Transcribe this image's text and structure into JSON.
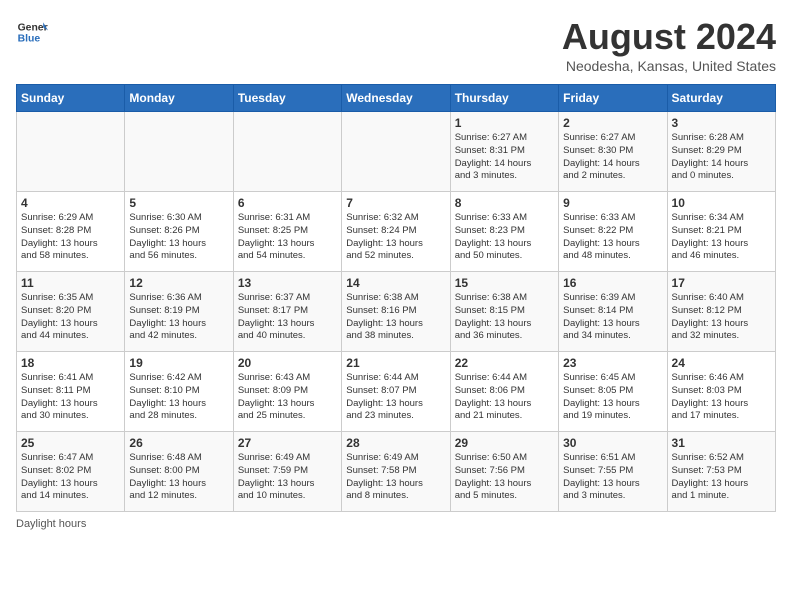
{
  "logo": {
    "line1": "General",
    "line2": "Blue"
  },
  "title": "August 2024",
  "subtitle": "Neodesha, Kansas, United States",
  "days_of_week": [
    "Sunday",
    "Monday",
    "Tuesday",
    "Wednesday",
    "Thursday",
    "Friday",
    "Saturday"
  ],
  "footer_text": "Daylight hours",
  "weeks": [
    [
      {
        "day": "",
        "info": ""
      },
      {
        "day": "",
        "info": ""
      },
      {
        "day": "",
        "info": ""
      },
      {
        "day": "",
        "info": ""
      },
      {
        "day": "1",
        "info": "Sunrise: 6:27 AM\nSunset: 8:31 PM\nDaylight: 14 hours\nand 3 minutes."
      },
      {
        "day": "2",
        "info": "Sunrise: 6:27 AM\nSunset: 8:30 PM\nDaylight: 14 hours\nand 2 minutes."
      },
      {
        "day": "3",
        "info": "Sunrise: 6:28 AM\nSunset: 8:29 PM\nDaylight: 14 hours\nand 0 minutes."
      }
    ],
    [
      {
        "day": "4",
        "info": "Sunrise: 6:29 AM\nSunset: 8:28 PM\nDaylight: 13 hours\nand 58 minutes."
      },
      {
        "day": "5",
        "info": "Sunrise: 6:30 AM\nSunset: 8:26 PM\nDaylight: 13 hours\nand 56 minutes."
      },
      {
        "day": "6",
        "info": "Sunrise: 6:31 AM\nSunset: 8:25 PM\nDaylight: 13 hours\nand 54 minutes."
      },
      {
        "day": "7",
        "info": "Sunrise: 6:32 AM\nSunset: 8:24 PM\nDaylight: 13 hours\nand 52 minutes."
      },
      {
        "day": "8",
        "info": "Sunrise: 6:33 AM\nSunset: 8:23 PM\nDaylight: 13 hours\nand 50 minutes."
      },
      {
        "day": "9",
        "info": "Sunrise: 6:33 AM\nSunset: 8:22 PM\nDaylight: 13 hours\nand 48 minutes."
      },
      {
        "day": "10",
        "info": "Sunrise: 6:34 AM\nSunset: 8:21 PM\nDaylight: 13 hours\nand 46 minutes."
      }
    ],
    [
      {
        "day": "11",
        "info": "Sunrise: 6:35 AM\nSunset: 8:20 PM\nDaylight: 13 hours\nand 44 minutes."
      },
      {
        "day": "12",
        "info": "Sunrise: 6:36 AM\nSunset: 8:19 PM\nDaylight: 13 hours\nand 42 minutes."
      },
      {
        "day": "13",
        "info": "Sunrise: 6:37 AM\nSunset: 8:17 PM\nDaylight: 13 hours\nand 40 minutes."
      },
      {
        "day": "14",
        "info": "Sunrise: 6:38 AM\nSunset: 8:16 PM\nDaylight: 13 hours\nand 38 minutes."
      },
      {
        "day": "15",
        "info": "Sunrise: 6:38 AM\nSunset: 8:15 PM\nDaylight: 13 hours\nand 36 minutes."
      },
      {
        "day": "16",
        "info": "Sunrise: 6:39 AM\nSunset: 8:14 PM\nDaylight: 13 hours\nand 34 minutes."
      },
      {
        "day": "17",
        "info": "Sunrise: 6:40 AM\nSunset: 8:12 PM\nDaylight: 13 hours\nand 32 minutes."
      }
    ],
    [
      {
        "day": "18",
        "info": "Sunrise: 6:41 AM\nSunset: 8:11 PM\nDaylight: 13 hours\nand 30 minutes."
      },
      {
        "day": "19",
        "info": "Sunrise: 6:42 AM\nSunset: 8:10 PM\nDaylight: 13 hours\nand 28 minutes."
      },
      {
        "day": "20",
        "info": "Sunrise: 6:43 AM\nSunset: 8:09 PM\nDaylight: 13 hours\nand 25 minutes."
      },
      {
        "day": "21",
        "info": "Sunrise: 6:44 AM\nSunset: 8:07 PM\nDaylight: 13 hours\nand 23 minutes."
      },
      {
        "day": "22",
        "info": "Sunrise: 6:44 AM\nSunset: 8:06 PM\nDaylight: 13 hours\nand 21 minutes."
      },
      {
        "day": "23",
        "info": "Sunrise: 6:45 AM\nSunset: 8:05 PM\nDaylight: 13 hours\nand 19 minutes."
      },
      {
        "day": "24",
        "info": "Sunrise: 6:46 AM\nSunset: 8:03 PM\nDaylight: 13 hours\nand 17 minutes."
      }
    ],
    [
      {
        "day": "25",
        "info": "Sunrise: 6:47 AM\nSunset: 8:02 PM\nDaylight: 13 hours\nand 14 minutes."
      },
      {
        "day": "26",
        "info": "Sunrise: 6:48 AM\nSunset: 8:00 PM\nDaylight: 13 hours\nand 12 minutes."
      },
      {
        "day": "27",
        "info": "Sunrise: 6:49 AM\nSunset: 7:59 PM\nDaylight: 13 hours\nand 10 minutes."
      },
      {
        "day": "28",
        "info": "Sunrise: 6:49 AM\nSunset: 7:58 PM\nDaylight: 13 hours\nand 8 minutes."
      },
      {
        "day": "29",
        "info": "Sunrise: 6:50 AM\nSunset: 7:56 PM\nDaylight: 13 hours\nand 5 minutes."
      },
      {
        "day": "30",
        "info": "Sunrise: 6:51 AM\nSunset: 7:55 PM\nDaylight: 13 hours\nand 3 minutes."
      },
      {
        "day": "31",
        "info": "Sunrise: 6:52 AM\nSunset: 7:53 PM\nDaylight: 13 hours\nand 1 minute."
      }
    ]
  ]
}
